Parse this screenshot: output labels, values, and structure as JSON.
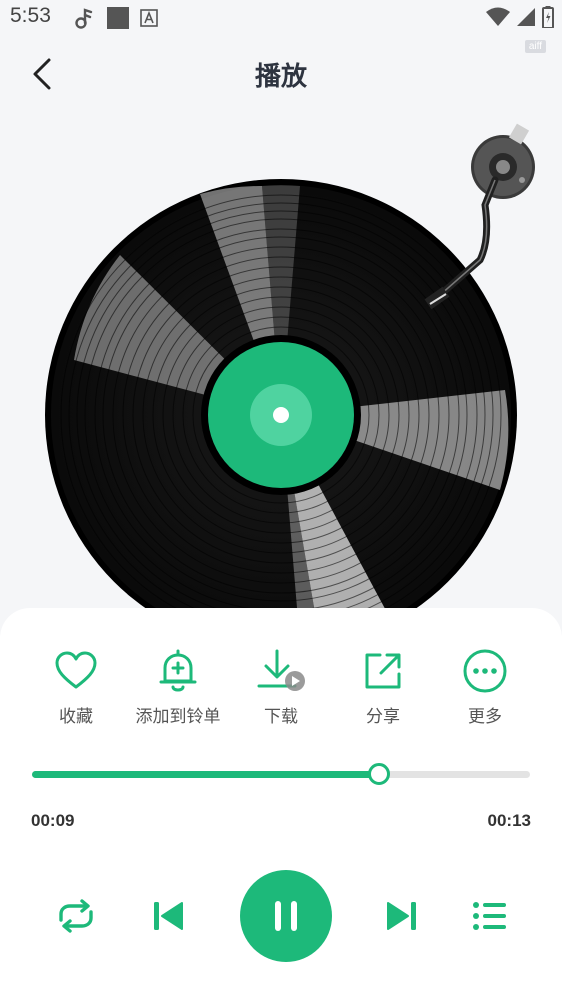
{
  "status_bar": {
    "time": "5:53",
    "icons_left": [
      "music-note-icon",
      "square-icon",
      "font-icon"
    ],
    "icons_right": [
      "wifi-icon",
      "signal-icon",
      "battery-icon"
    ]
  },
  "badge": "aiff",
  "header": {
    "title": "播放",
    "back_icon": "chevron-left-icon"
  },
  "turntable": {
    "record_label_color": "#1db97a",
    "record_center_color": "#4fd3a0",
    "tonearm_icon": "tonearm-icon"
  },
  "actions": [
    {
      "label": "收藏",
      "icon": "heart-icon"
    },
    {
      "label": "添加到铃单",
      "icon": "bell-plus-icon"
    },
    {
      "label": "下载",
      "icon": "download-icon"
    },
    {
      "label": "分享",
      "icon": "share-icon"
    },
    {
      "label": "更多",
      "icon": "more-icon"
    }
  ],
  "playback": {
    "current_time": "00:09",
    "total_time": "00:13",
    "progress": 0.696
  },
  "controls": {
    "repeat_icon": "repeat-icon",
    "previous_icon": "skip-previous-icon",
    "play_pause_icon": "pause-icon",
    "next_icon": "skip-next-icon",
    "playlist_icon": "playlist-icon"
  },
  "colors": {
    "accent": "#1db97a",
    "background": "#f5f6f8",
    "panel": "#ffffff"
  }
}
